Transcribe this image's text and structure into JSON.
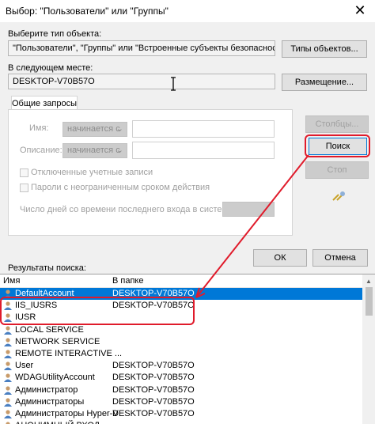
{
  "window": {
    "title": "Выбор: \"Пользователи\" или \"Группы\"",
    "close_glyph": "✕"
  },
  "object_type": {
    "label": "Выберите тип объекта:",
    "value": "\"Пользователи\", \"Группы\" или \"Встроенные субъекты безопасности\"",
    "button": "Типы объектов..."
  },
  "location": {
    "label": "В следующем месте:",
    "value": "DESKTOP-V70B57O",
    "button": "Размещение..."
  },
  "common_queries": {
    "tab": "Общие запросы",
    "name_label": "Имя:",
    "name_mode": "начинается с",
    "desc_label": "Описание:",
    "desc_mode": "начинается с",
    "disabled_accounts": "Отключенные учетные записи",
    "non_expiring": "Пароли с неограниченным сроком действия",
    "days_label": "Число дней со времени последнего входа в систему:"
  },
  "buttons": {
    "columns": "Столбцы...",
    "search": "Поиск",
    "stop": "Стоп",
    "ok": "ОК",
    "cancel": "Отмена"
  },
  "results": {
    "label": "Результаты поиска:",
    "col_name": "Имя",
    "col_folder": "В папке",
    "rows": [
      {
        "name": "DefaultAccount",
        "folder": "DESKTOP-V70B57O"
      },
      {
        "name": "IIS_IUSRS",
        "folder": "DESKTOP-V70B57O"
      },
      {
        "name": "IUSR",
        "folder": ""
      },
      {
        "name": "LOCAL SERVICE",
        "folder": ""
      },
      {
        "name": "NETWORK SERVICE",
        "folder": ""
      },
      {
        "name": "REMOTE INTERACTIVE ...",
        "folder": ""
      },
      {
        "name": "User",
        "folder": "DESKTOP-V70B57O"
      },
      {
        "name": "WDAGUtilityAccount",
        "folder": "DESKTOP-V70B57O"
      },
      {
        "name": "Администратор",
        "folder": "DESKTOP-V70B57O"
      },
      {
        "name": "Администраторы",
        "folder": "DESKTOP-V70B57O"
      },
      {
        "name": "Администраторы Hyper-V",
        "folder": "DESKTOP-V70B57O"
      },
      {
        "name": "АНОНИМНЫЙ ВХОД",
        "folder": ""
      }
    ]
  },
  "colors": {
    "selection": "#0078d7",
    "annotation": "#e01b2b"
  }
}
